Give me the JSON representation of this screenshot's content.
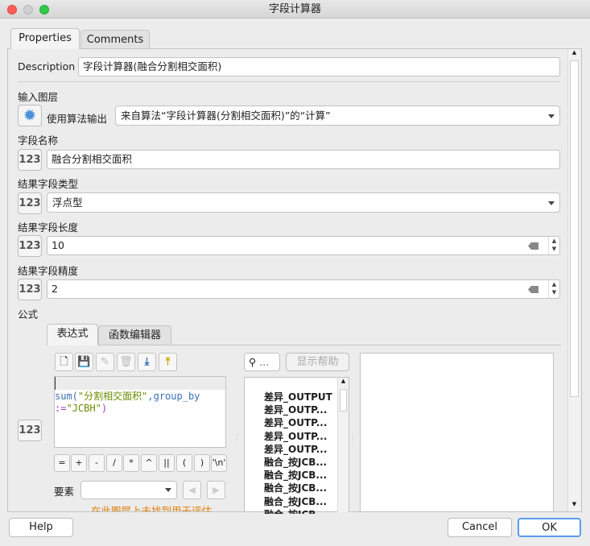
{
  "window": {
    "title": "字段计算器"
  },
  "tabs": [
    {
      "label": "Properties"
    },
    {
      "label": "Comments"
    }
  ],
  "description": {
    "label": "Description",
    "value": "字段计算器(融合分割相交面积)"
  },
  "input_layer": {
    "label": "输入图层",
    "source_label": "使用算法输出",
    "value": "来自算法“字段计算器(分割相交面积)”的“计算”"
  },
  "field_name": {
    "label": "字段名称",
    "value": "融合分割相交面积"
  },
  "field_type": {
    "label": "结果字段类型",
    "value": "浮点型"
  },
  "field_length": {
    "label": "结果字段长度",
    "value": "10"
  },
  "field_precision": {
    "label": "结果字段精度",
    "value": "2"
  },
  "formula": {
    "label": "公式",
    "tabs": [
      {
        "label": "表达式"
      },
      {
        "label": "函数编辑器"
      }
    ],
    "expr_parts": {
      "fn": "sum(",
      "field": "\"分割相交面积\"",
      "sep": ",",
      "kw": "group_by",
      "line2a": ":=",
      "line2b": "\"JCBH\"",
      "close": ")"
    },
    "operators": [
      "=",
      "+",
      "-",
      "/",
      "*",
      "^",
      "||",
      "(",
      ")",
      "'\\n'"
    ],
    "feature_label": "要素",
    "feature_value": "",
    "warning": "在此图层上未找到用于评估",
    "search_placeholder": "...",
    "help_button": "显示帮助",
    "list": [
      "差异_OUTPUT",
      "差异_OUTP...",
      "差异_OUTP...",
      "差异_OUTP...",
      "差异_OUTP...",
      "融合_按JCB...",
      "融合_按JCB...",
      "融合_按JCB...",
      "融合_按JCB...",
      "融合_按JCB..."
    ]
  },
  "buttons": {
    "help": "Help",
    "cancel": "Cancel",
    "ok": "OK"
  },
  "colors": {
    "accent": "#3b82f6",
    "warning": "#e07b00",
    "fn": "#3c6fb4",
    "string": "#6a8c00",
    "keyword": "#9a3fb8"
  }
}
